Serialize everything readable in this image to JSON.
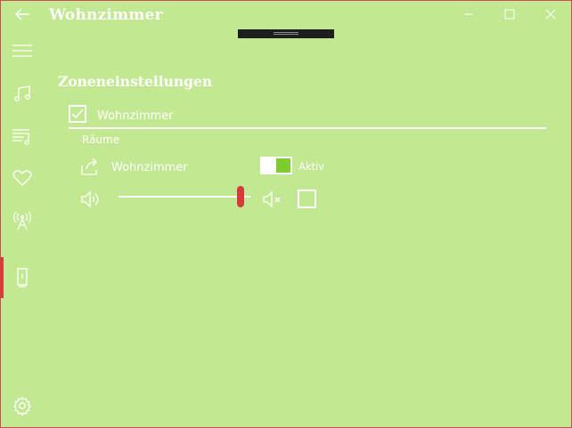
{
  "window": {
    "title": "Wohnzimmer",
    "back_icon": "back-arrow-icon",
    "controls": [
      "minimize-icon",
      "maximize-icon",
      "close-icon"
    ]
  },
  "sidebar": {
    "items": [
      {
        "icon": "hamburger-icon"
      },
      {
        "icon": "music-note-icon"
      },
      {
        "icon": "playlist-icon"
      },
      {
        "icon": "heart-icon"
      },
      {
        "icon": "radio-tower-icon"
      },
      {
        "icon": "speaker-device-icon",
        "selected": true
      },
      {
        "icon": "settings-gear-icon"
      }
    ]
  },
  "main": {
    "section_title": "Zoneneinstellungen",
    "zone": {
      "checked": true,
      "label": "Wohnzimmer"
    },
    "rooms_label": "Räume",
    "room": {
      "name": "Wohnzimmer",
      "share_icon": "share-icon",
      "toggle_on": true,
      "toggle_label": "Aktiv",
      "volume_icon": "volume-icon",
      "volume_fraction": 0.95,
      "mute_icon": "mute-icon",
      "mute_checked": false
    }
  },
  "colors": {
    "background": "#c2e892",
    "accent_red": "#d63b3b",
    "toggle_green": "#7dcc30",
    "foreground": "#ffffff"
  }
}
